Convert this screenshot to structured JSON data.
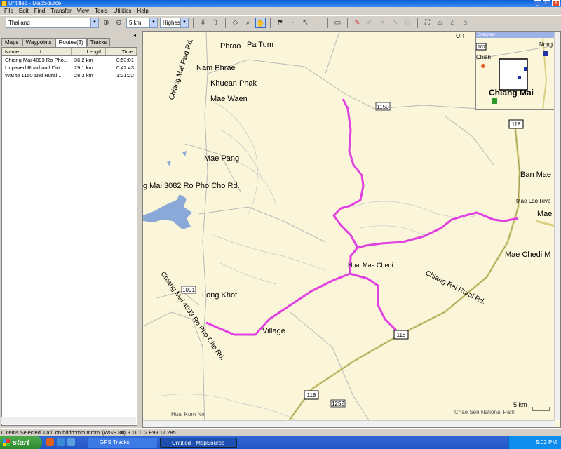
{
  "window": {
    "title": "Untitled - MapSource"
  },
  "menu": [
    "File",
    "Edit",
    "Find",
    "Transfer",
    "View",
    "Tools",
    "Utilities",
    "Help"
  ],
  "toolbar": {
    "map_product": "Thailand",
    "zoom_level": "5 km",
    "detail": "Highest"
  },
  "left_panel": {
    "tabs": [
      "Maps",
      "Waypoints",
      "Routes(3)",
      "Tracks"
    ],
    "active_tab": "Routes(3)",
    "columns": [
      "Name",
      "/",
      "Length",
      "Time"
    ],
    "routes": [
      {
        "name": "Chiang Mai 4093 Ro Pho...",
        "length": "36.2 km",
        "time": "0:53:01"
      },
      {
        "name": "Unpaved Road and Dirt ...",
        "length": "29.1 km",
        "time": "0:42:43"
      },
      {
        "name": "Wat to 1150 and Rural ...",
        "length": "28.3 km",
        "time": "1:21:22"
      }
    ]
  },
  "map": {
    "place_labels": [
      "Phrao",
      "Pa Tum",
      "Nam Phrae",
      "Khuean Phak",
      "Mae Waen",
      "Mae Pang",
      "Long Khot",
      "Village",
      "Huai Mae Chedi",
      "Ban Mae",
      "Mae Chedi M",
      "Mae Lao Rive",
      "Mae",
      "Chiang Mai",
      "on",
      "Chian",
      "Nong H",
      "Huai Kom Noi",
      "Chae Sen National Park"
    ],
    "road_labels": [
      "Chiang Mai Pwd Rd.",
      "g Mai 3082 Ro Pho Cho Rd.",
      "Chiang Mai 4093 Ro Pho Cho Rd.",
      "Chiang Rai Rural Rd."
    ],
    "shields": [
      "1150",
      "118",
      "118",
      "118",
      "1001",
      "1252",
      "107"
    ],
    "scale": "5 km",
    "overview_title": "Overview",
    "overview_label": "Chiang Mai",
    "colors": {
      "route": "#e040e0",
      "map_bg": "#fbf6d9",
      "highway": "#d8d080",
      "water": "#8aa8d8"
    }
  },
  "status": {
    "selected": "0 Items Selected",
    "format": "Lat/Lon hddd°mm.mmm' (WGS 84)",
    "coords": "N19 11.102 E99 17.285"
  },
  "taskbar": {
    "start": "start",
    "tasks": [
      "GPS Tracks",
      "Untitled - MapSource"
    ],
    "clock": "5:02 PM"
  }
}
